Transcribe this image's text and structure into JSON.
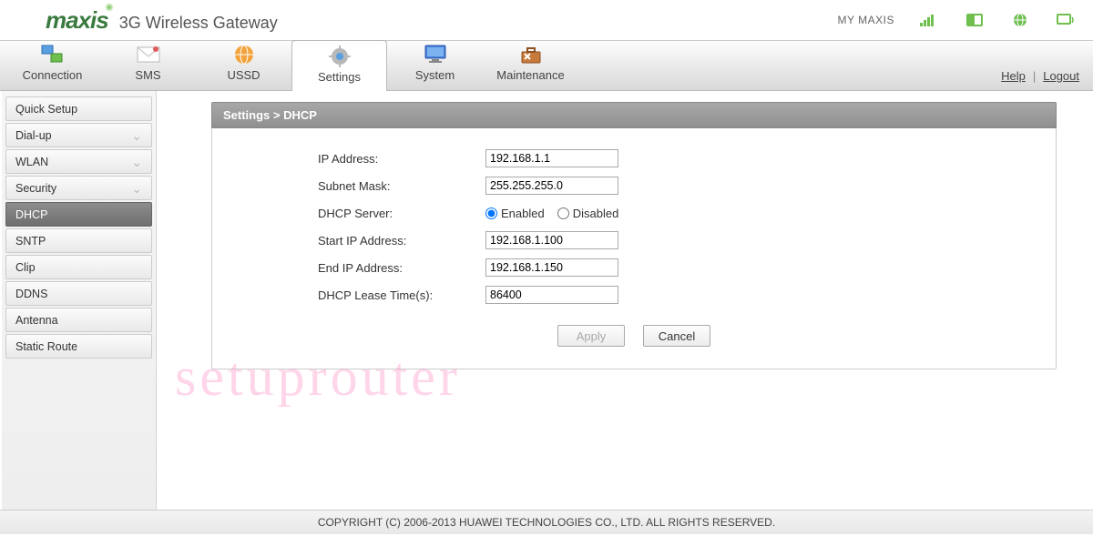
{
  "header": {
    "brand": "maxis",
    "title": "3G Wireless Gateway",
    "my_maxis": "MY MAXIS"
  },
  "status_icons": {
    "signal": "signal-icon",
    "sim": "sim-icon",
    "globe": "globe-icon",
    "screen": "screen-icon"
  },
  "topnav": {
    "items": [
      {
        "label": "Connection",
        "icon": "connection-icon"
      },
      {
        "label": "SMS",
        "icon": "sms-icon"
      },
      {
        "label": "USSD",
        "icon": "ussd-icon"
      },
      {
        "label": "Settings",
        "icon": "settings-icon"
      },
      {
        "label": "System",
        "icon": "system-icon"
      },
      {
        "label": "Maintenance",
        "icon": "maintenance-icon"
      }
    ],
    "active_index": 3,
    "help": "Help",
    "logout": "Logout"
  },
  "sidebar": {
    "items": [
      {
        "label": "Quick Setup",
        "expandable": false
      },
      {
        "label": "Dial-up",
        "expandable": true
      },
      {
        "label": "WLAN",
        "expandable": true
      },
      {
        "label": "Security",
        "expandable": true
      },
      {
        "label": "DHCP",
        "expandable": false,
        "active": true
      },
      {
        "label": "SNTP",
        "expandable": false
      },
      {
        "label": "Clip",
        "expandable": false
      },
      {
        "label": "DDNS",
        "expandable": false
      },
      {
        "label": "Antenna",
        "expandable": false
      },
      {
        "label": "Static Route",
        "expandable": false
      }
    ]
  },
  "panel": {
    "breadcrumb": "Settings > DHCP",
    "fields": {
      "ip_address": {
        "label": "IP Address:",
        "value": "192.168.1.1"
      },
      "subnet_mask": {
        "label": "Subnet Mask:",
        "value": "255.255.255.0"
      },
      "dhcp_server": {
        "label": "DHCP Server:",
        "enabled_label": "Enabled",
        "disabled_label": "Disabled",
        "value": "enabled"
      },
      "start_ip": {
        "label": "Start IP Address:",
        "value": "192.168.1.100"
      },
      "end_ip": {
        "label": "End IP Address:",
        "value": "192.168.1.150"
      },
      "lease_time": {
        "label": "DHCP Lease Time(s):",
        "value": "86400"
      }
    },
    "actions": {
      "apply": "Apply",
      "cancel": "Cancel"
    }
  },
  "watermark": "setuprouter",
  "footer": "COPYRIGHT (C) 2006-2013 HUAWEI TECHNOLOGIES CO., LTD. ALL RIGHTS RESERVED.",
  "colors": {
    "accent_green": "#6fbf4f",
    "brand_green": "#3b7a3f"
  }
}
